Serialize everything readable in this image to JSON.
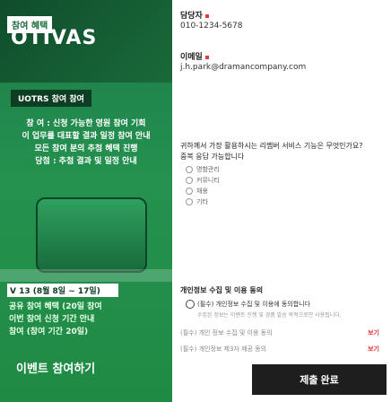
{
  "poster": {
    "tag": "참여 혜택",
    "logo": "OTIVAS",
    "button": "UOTRS 참여 참여",
    "line1": "참 여 : 신청 가능한 영원 참여 기회",
    "line2": "이 업무를 대표할 결과 일정 참여 안내",
    "line3": "모든 참여 분의 추첨 혜택 진행",
    "line4": "당첨 : 추첨 결과 및 일정 안내",
    "vip": "V 13 (8월 8일 ~ 17일)",
    "body1": "공유 참여 혜택 (20일 참여",
    "body2": "이번 참여 신청 기간 안내",
    "body3": "참여 (참여 기간 20일)",
    "bottom": "이벤트 참여하기"
  },
  "contact": {
    "name_label": "담당자",
    "phone": "010-1234-5678",
    "email_label": "이메일",
    "email": "j.h.park@dramancompany.com"
  },
  "question": {
    "line1": "귀하께서 가장 활용하시는 리멤버 서비스 기능은 무엇인가요?",
    "line2": "중복 응답 가능합니다"
  },
  "choices": [
    "명함관리",
    "커뮤니티",
    "채용",
    "기타"
  ],
  "consent": {
    "title": "개인정보 수집 및 이용 동의",
    "agree_all": "(필수) 개인정보 수집 및 이용에 동의합니다",
    "agree_all_desc": "수집된 정보는 이벤트 진행 및 경품 발송 목적으로만 사용됩니다.",
    "row1_label": "(필수) 개인 정보 수집 및 이용 동의",
    "row1_value": "보기",
    "row2_label": "(필수) 개인정보 제3자 제공 동의",
    "row2_value": "보기"
  },
  "submit_label": "제출 완료"
}
